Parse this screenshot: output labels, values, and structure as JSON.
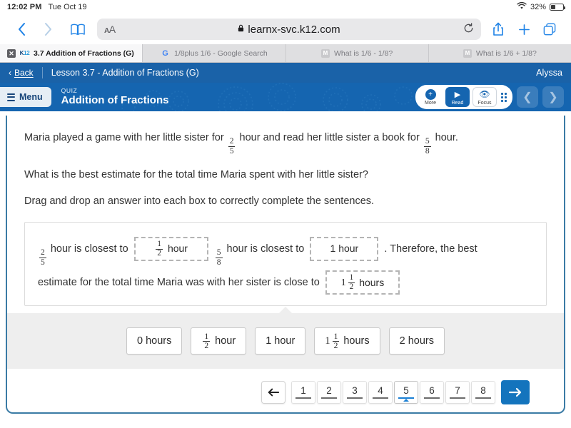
{
  "status_bar": {
    "time": "12:02 PM",
    "date": "Tue Oct 19",
    "wifi_icon": "wifi-icon",
    "battery_percent": "32%"
  },
  "browser": {
    "back_icon": "chevron-left-icon",
    "forward_icon": "chevron-right-icon",
    "bookmarks_icon": "book-icon",
    "text_size_label": "AA",
    "lock_icon": "lock-icon",
    "url": "learnx-svc.k12.com",
    "reload_icon": "reload-icon",
    "share_icon": "share-icon",
    "new_tab_icon": "plus-icon",
    "tabs_icon": "tabs-icon",
    "tabs": [
      {
        "title": "3.7 Addition of Fractions (G)",
        "favicon": "k12-favicon",
        "active": true,
        "close_icon": "close-icon"
      },
      {
        "title": "1/8plus 1/6 - Google Search",
        "favicon": "google-favicon",
        "active": false
      },
      {
        "title": "What is 1/6 - 1/8?",
        "favicon": "mathway-favicon",
        "active": false
      },
      {
        "title": "What is 1/6 + 1/8?",
        "favicon": "mathway-favicon",
        "active": false
      }
    ]
  },
  "lesson_header": {
    "back_icon": "chevron-left-icon",
    "back_label": "Back",
    "title": "Lesson 3.7 - Addition of Fractions (G)",
    "user": "Alyssa"
  },
  "quiz_header": {
    "menu_icon": "hamburger-icon",
    "menu_label": "Menu",
    "kicker": "QUIZ",
    "title": "Addition of Fractions",
    "tools": [
      {
        "label": "More",
        "icon": "plus-circle-icon",
        "style": "plain"
      },
      {
        "label": "Read",
        "icon": "play-icon",
        "style": "primary"
      },
      {
        "label": "Focus",
        "icon": "eye-icon",
        "style": "outlined"
      }
    ],
    "grid_icon": "grid-dots-icon",
    "prev_icon": "chevron-left-icon",
    "next_icon": "chevron-right-icon"
  },
  "question": {
    "line1_pre": "Maria played a game with her little sister for",
    "frac1": {
      "num": "2",
      "den": "5"
    },
    "line1_mid": "hour and read her little sister a book for",
    "frac2": {
      "num": "5",
      "den": "8"
    },
    "line1_post": "hour.",
    "line2": "What is the best estimate for the total time Maria spent with her little sister?",
    "line3": "Drag and drop an answer into each box to correctly complete the sentences."
  },
  "answer_area": {
    "s1_frac": {
      "num": "2",
      "den": "5"
    },
    "s1_text_a": "hour is closest to",
    "drop1": {
      "whole": "",
      "num": "1",
      "den": "2",
      "unit": "hour"
    },
    "s1_frac2": {
      "num": "5",
      "den": "8"
    },
    "s1_text_b": "hour is closest to",
    "drop2": {
      "plain": "1 hour"
    },
    "s1_text_c": ". Therefore, the best",
    "s2_text": "estimate for the total time Maria was with her sister is close to",
    "drop3": {
      "whole": "1",
      "num": "1",
      "den": "2",
      "unit": "hours"
    }
  },
  "choices": [
    {
      "plain": "0 hours"
    },
    {
      "num": "1",
      "den": "2",
      "unit": "hour"
    },
    {
      "plain": "1 hour"
    },
    {
      "whole": "1",
      "num": "1",
      "den": "2",
      "unit": "hours"
    },
    {
      "plain": "2 hours"
    }
  ],
  "pagination": {
    "prev_icon": "arrow-left-icon",
    "pages": [
      "1",
      "2",
      "3",
      "4",
      "5",
      "6",
      "7",
      "8"
    ],
    "current_page": "5",
    "next_icon": "arrow-right-icon"
  },
  "colors": {
    "brand_blue": "#1565b0",
    "header_blue": "#1a62a8",
    "panel_border": "#3a7ba5",
    "accent": "#1a7fd4",
    "next_button": "#1474bd"
  }
}
